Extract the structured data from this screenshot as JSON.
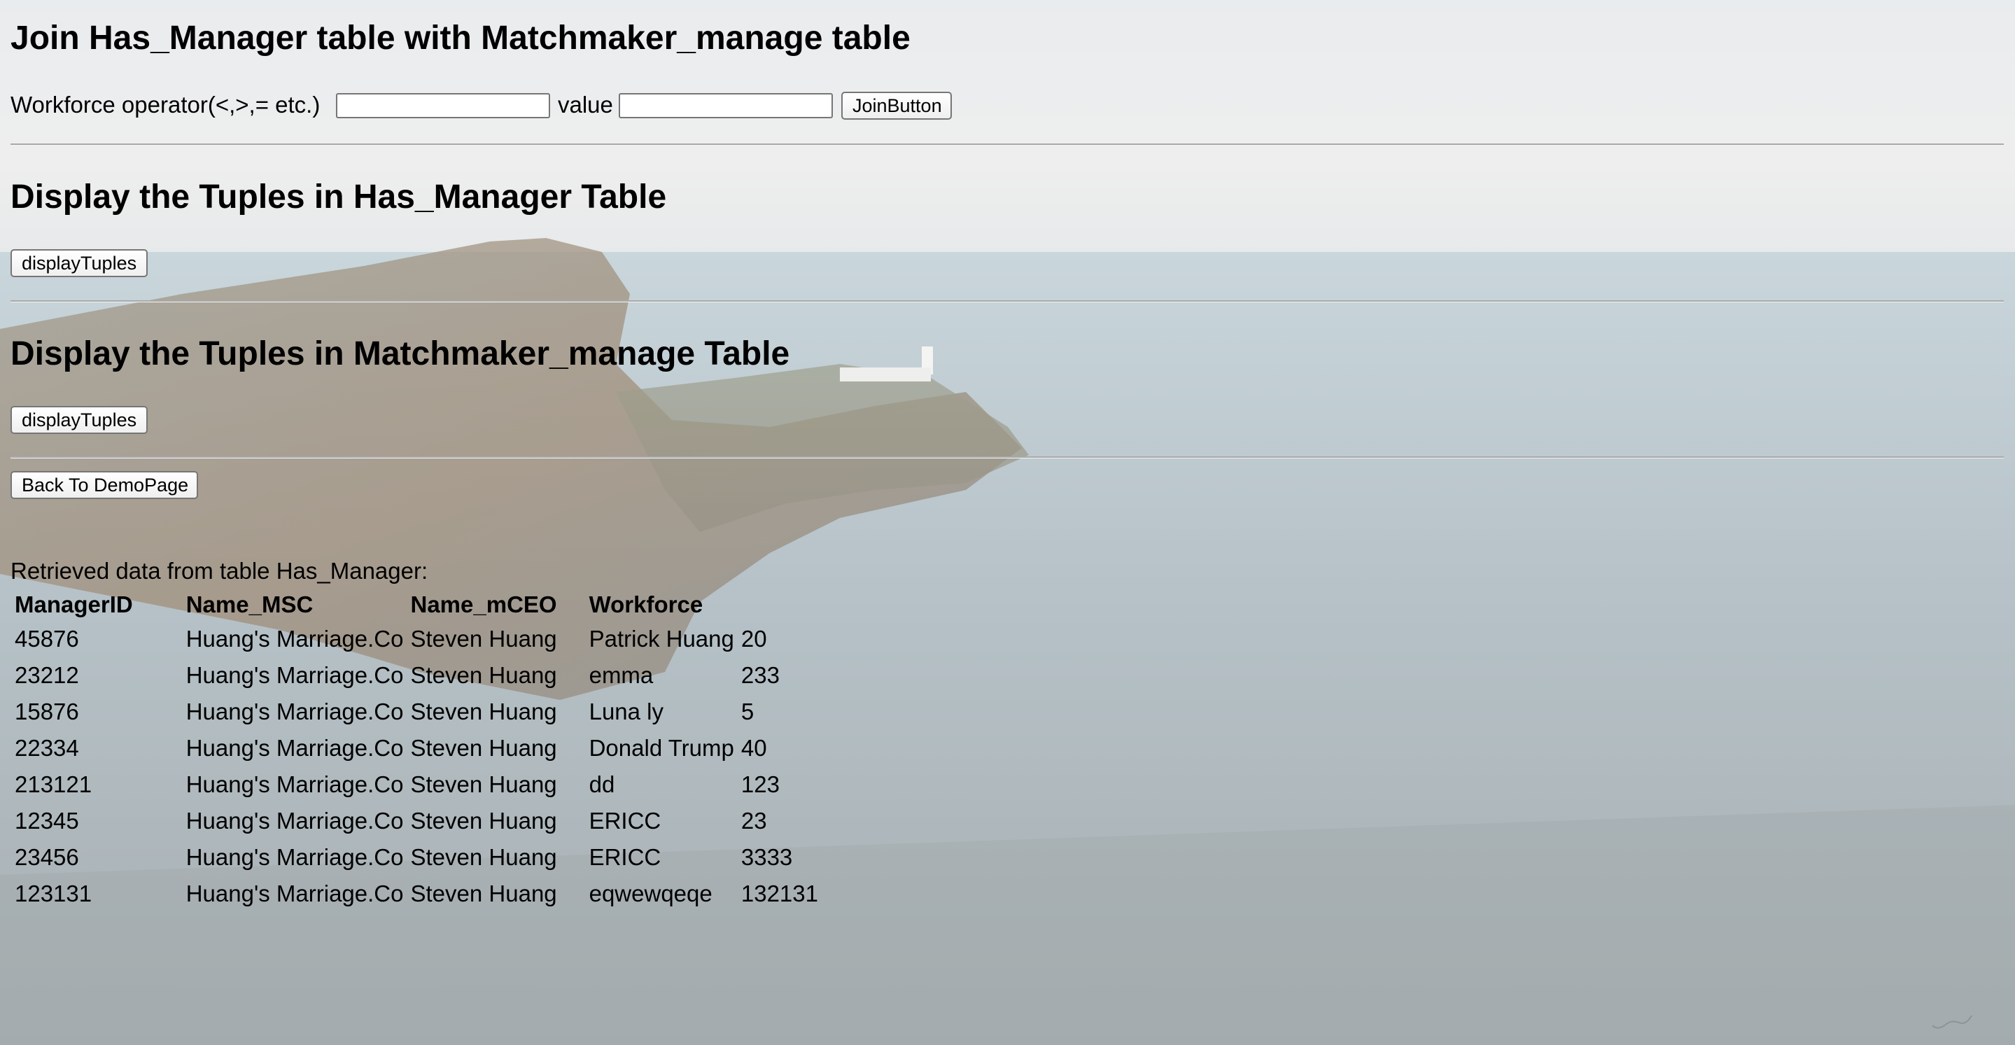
{
  "join_section": {
    "title": "Join Has_Manager table with Matchmaker_manage table",
    "operator_label": "Workforce operator(<,>,= etc.)",
    "operator_value": "",
    "value_label": "value",
    "value_value": "",
    "join_button": "JoinButton"
  },
  "display_has_manager": {
    "title": "Display the Tuples in Has_Manager Table",
    "button": "displayTuples"
  },
  "display_matchmaker": {
    "title": "Display the Tuples in Matchmaker_manage Table",
    "button": "displayTuples"
  },
  "back_button": "Back To DemoPage",
  "result": {
    "caption": "Retrieved data from table Has_Manager:",
    "columns": [
      "ManagerID",
      "Name_MSC",
      "Name_mCEO",
      "Workforce"
    ],
    "rows": [
      [
        "45876",
        "Huang's Marriage.Co",
        "Steven Huang",
        "Patrick Huang",
        "20"
      ],
      [
        "23212",
        "Huang's Marriage.Co",
        "Steven Huang",
        "emma",
        "233"
      ],
      [
        "15876",
        "Huang's Marriage.Co",
        "Steven Huang",
        "Luna ly",
        "5"
      ],
      [
        "22334",
        "Huang's Marriage.Co",
        "Steven Huang",
        "Donald Trump",
        "40"
      ],
      [
        "213121",
        "Huang's Marriage.Co",
        "Steven Huang",
        "dd",
        "123"
      ],
      [
        "12345",
        "Huang's Marriage.Co",
        "Steven Huang",
        "ERICC",
        "23"
      ],
      [
        "23456",
        "Huang's Marriage.Co",
        "Steven Huang",
        "ERICC",
        "3333"
      ],
      [
        "123131",
        "Huang's Marriage.Co",
        "Steven Huang",
        "eqwewqeqe",
        "132131"
      ]
    ]
  }
}
